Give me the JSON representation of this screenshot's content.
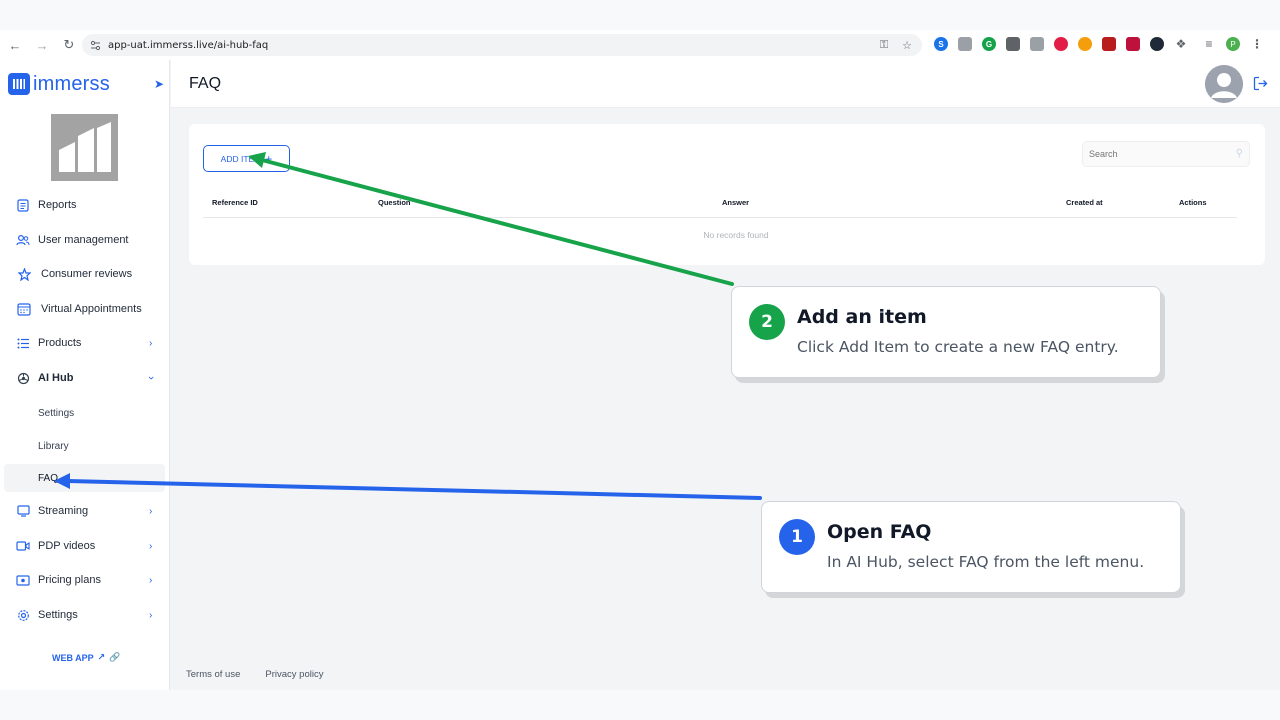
{
  "browser": {
    "url": "app-uat.immerss.live/ai-hub-faq",
    "profile_initial": "P"
  },
  "app": {
    "brand": "immerss",
    "page_title": "FAQ"
  },
  "sidebar": {
    "items": [
      {
        "label": "Reports",
        "icon": "reports-icon"
      },
      {
        "label": "User management",
        "icon": "users-icon"
      },
      {
        "label": "Consumer reviews",
        "icon": "star-icon"
      },
      {
        "label": "Virtual Appointments",
        "icon": "calendar-icon"
      },
      {
        "label": "Products",
        "icon": "list-icon"
      },
      {
        "label": "AI Hub",
        "icon": "ai-hub-icon"
      },
      {
        "label": "Streaming",
        "icon": "monitor-icon"
      },
      {
        "label": "PDP videos",
        "icon": "video-icon"
      },
      {
        "label": "Pricing plans",
        "icon": "money-icon"
      },
      {
        "label": "Settings",
        "icon": "gear-icon"
      }
    ],
    "ai_hub_subitems": [
      {
        "label": "Settings"
      },
      {
        "label": "Library"
      },
      {
        "label": "FAQ",
        "active": true
      }
    ],
    "web_app_link": "WEB APP"
  },
  "content": {
    "add_item_label": "ADD ITEM",
    "search_placeholder": "Search",
    "table_headers": [
      "Reference ID",
      "Question",
      "Answer",
      "Created at",
      "Actions"
    ],
    "empty_text": "No records found"
  },
  "footer": {
    "terms": "Terms of use",
    "privacy": "Privacy policy"
  },
  "callouts": [
    {
      "number": "2",
      "title": "Add an item",
      "body": "Click Add Item to create a new FAQ entry.",
      "color": "#16a34a"
    },
    {
      "number": "1",
      "title": "Open FAQ",
      "body": "In AI Hub, select FAQ from the left menu.",
      "color": "#2563eb"
    }
  ]
}
